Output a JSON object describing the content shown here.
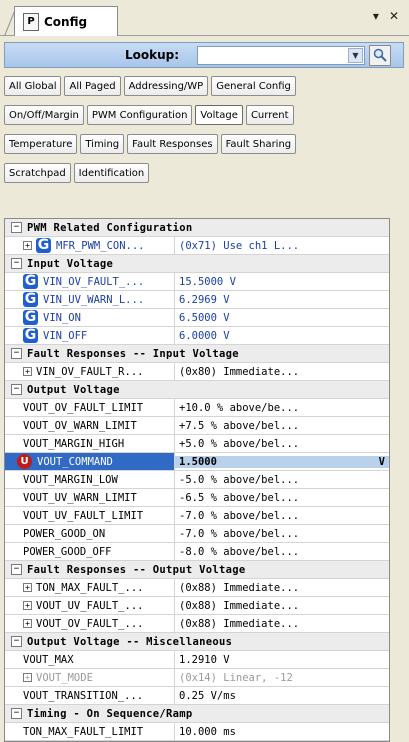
{
  "panel": {
    "tab_label": "Config",
    "tab_icon": "P",
    "pin_glyph": "▾",
    "close_glyph": "✕"
  },
  "lookup": {
    "label": "Lookup:",
    "value": ""
  },
  "button_rows": [
    [
      "All Global",
      "All Paged",
      "Addressing/WP",
      "General Config"
    ],
    [
      "On/Off/Margin",
      "PWM Configuration",
      "Voltage",
      "Current"
    ],
    [
      "Temperature",
      "Timing",
      "Fault Responses",
      "Fault Sharing"
    ],
    [
      "Scratchpad",
      "Identification"
    ]
  ],
  "active_button": "Voltage",
  "tree": {
    "s1": {
      "title": "PWM Related Configuration",
      "rows": [
        {
          "name": "MFR_PWM_CON...",
          "value": "(0x71) Use ch1 L..."
        }
      ]
    },
    "s2": {
      "title": "Input Voltage",
      "rows": [
        {
          "name": "VIN_OV_FAULT_...",
          "value": "15.5000 V"
        },
        {
          "name": "VIN_UV_WARN_L...",
          "value": "6.2969 V"
        },
        {
          "name": "VIN_ON",
          "value": "6.5000 V"
        },
        {
          "name": "VIN_OFF",
          "value": "6.0000 V"
        }
      ]
    },
    "s3": {
      "title": "Fault Responses -- Input Voltage",
      "rows": [
        {
          "name": "VIN_OV_FAULT_R...",
          "value": "(0x80) Immediate..."
        }
      ]
    },
    "s4": {
      "title": "Output Voltage",
      "rows": [
        {
          "name": "VOUT_OV_FAULT_LIMIT",
          "value": "+10.0 % above/be..."
        },
        {
          "name": "VOUT_OV_WARN_LIMIT",
          "value": "+7.5 % above/bel..."
        },
        {
          "name": "VOUT_MARGIN_HIGH",
          "value": "+5.0 % above/bel..."
        },
        {
          "name": "VOUT_COMMAND",
          "value": "1.5000",
          "unit": "V"
        },
        {
          "name": "VOUT_MARGIN_LOW",
          "value": "-5.0 % above/bel..."
        },
        {
          "name": "VOUT_UV_WARN_LIMIT",
          "value": "-6.5 % above/bel..."
        },
        {
          "name": "VOUT_UV_FAULT_LIMIT",
          "value": "-7.0 % above/bel..."
        },
        {
          "name": "POWER_GOOD_ON",
          "value": "-7.0 % above/bel..."
        },
        {
          "name": "POWER_GOOD_OFF",
          "value": "-8.0 % above/bel..."
        }
      ]
    },
    "s5": {
      "title": "Fault Responses -- Output Voltage",
      "rows": [
        {
          "name": "TON_MAX_FAULT_...",
          "value": "(0x88) Immediate..."
        },
        {
          "name": "VOUT_UV_FAULT_...",
          "value": "(0x88) Immediate..."
        },
        {
          "name": "VOUT_OV_FAULT_...",
          "value": "(0x88) Immediate..."
        }
      ]
    },
    "s6": {
      "title": "Output Voltage -- Miscellaneous",
      "rows": [
        {
          "name": "VOUT_MAX",
          "value": "1.2910 V"
        },
        {
          "name": "VOUT_MODE",
          "value": "(0x14) Linear, -12"
        },
        {
          "name": "VOUT_TRANSITION_...",
          "value": "0.25 V/ms"
        }
      ]
    },
    "s7": {
      "title": "Timing - On Sequence/Ramp",
      "rows": [
        {
          "name": "TON_MAX_FAULT_LIMIT",
          "value": "10.000 ms"
        }
      ]
    }
  },
  "colors": {
    "selection": "#316ac5",
    "lookup_bar": "#b8d0ee",
    "g_icon": "#1f5fd0",
    "u_icon": "#c01b1b"
  },
  "icons": {
    "group": "G-icon",
    "user": "U-icon",
    "search": "search-icon"
  }
}
